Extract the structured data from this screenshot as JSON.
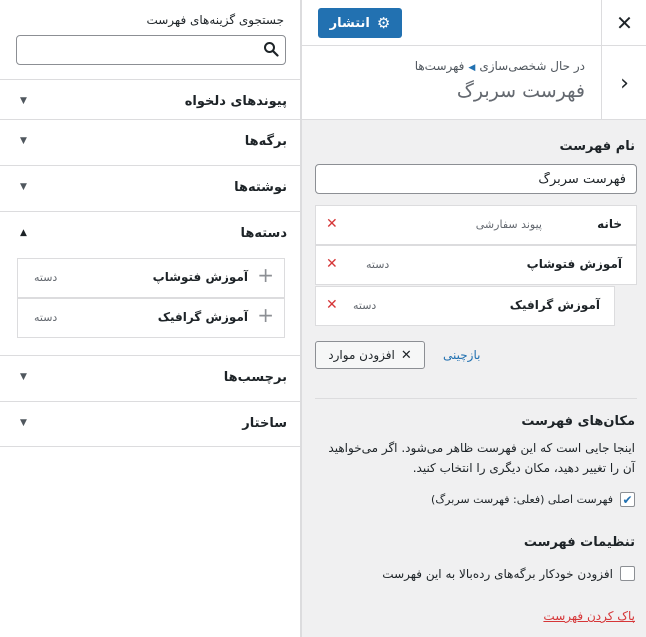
{
  "left_panel": {
    "search": {
      "label": "جستجوی گزینه‌های فهرست",
      "placeholder": ""
    },
    "sections": [
      {
        "title": "پیوندهای دلخواه",
        "expanded": false
      },
      {
        "title": "برگه‌ها",
        "expanded": false
      },
      {
        "title": "نوشته‌ها",
        "expanded": false
      },
      {
        "title": "دسته‌ها",
        "expanded": true,
        "items": [
          {
            "title": "آموزش فتوشاپ",
            "type": "دسته"
          },
          {
            "title": "آموزش گرافیک",
            "type": "دسته"
          }
        ]
      },
      {
        "title": "برچسب‌ها",
        "expanded": false
      },
      {
        "title": "ساختار",
        "expanded": false
      }
    ]
  },
  "right_panel": {
    "publish_label": "انتشار",
    "breadcrumb": {
      "part1": "در حال شخصی‌سازی",
      "part2": "فهرست‌ها"
    },
    "title": "فهرست سربرگ",
    "menu_name_label": "نام فهرست",
    "menu_name_value": "فهرست سربرگ",
    "menu_items": [
      {
        "title": "خانه",
        "type": "پیوند سفارشی"
      },
      {
        "title": "آموزش فتوشاپ",
        "type": "دسته"
      },
      {
        "title": "آموزش گرافیک",
        "type": "دسته"
      }
    ],
    "add_items_label": "افزودن موارد",
    "reorder_label": "بازچینی",
    "locations": {
      "heading": "مکان‌های فهرست",
      "description": "اینجا جایی است که این فهرست ظاهر می‌شود. اگر می‌خواهید آن را تغییر دهید، مکان دیگری را انتخاب کنید.",
      "primary_label": "فهرست اصلی (فعلی: فهرست سربرگ)",
      "primary_checked": true
    },
    "settings": {
      "heading": "تنظیمات فهرست",
      "auto_add_label": "افزودن خودکار برگه‌های رده‌بالا به این فهرست",
      "auto_add_checked": false
    },
    "delete_label": "پاک کردن فهرست"
  },
  "colors": {
    "accent": "#2271b1",
    "danger": "#d63638",
    "border": "#dcdcde",
    "background": "#f0f0f1"
  },
  "icons": {
    "close": "close-icon",
    "gear": "gear-icon",
    "back": "chevron-right-icon",
    "search": "search-icon",
    "remove": "remove-x-icon",
    "add": "plus-icon",
    "collapse": "triangle-down-icon",
    "expand": "triangle-up-icon"
  }
}
